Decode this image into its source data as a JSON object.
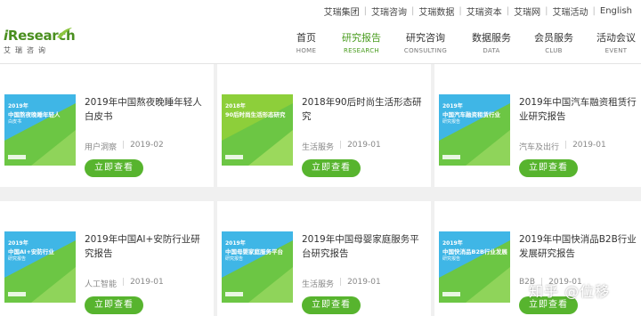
{
  "top_links": [
    "艾瑞集团",
    "艾瑞咨询",
    "艾瑞数据",
    "艾瑞资本",
    "艾瑞网",
    "艾瑞活动",
    "English"
  ],
  "logo": {
    "main_i": "i",
    "main_rest": "Research",
    "sub": "艾瑞咨询"
  },
  "nav": [
    {
      "cn": "首页",
      "en": "HOME"
    },
    {
      "cn": "研究报告",
      "en": "RESEARCH"
    },
    {
      "cn": "研究咨询",
      "en": "CONSULTING"
    },
    {
      "cn": "数据服务",
      "en": "DATA"
    },
    {
      "cn": "会员服务",
      "en": "CLUB"
    },
    {
      "cn": "活动会议",
      "en": "EVENT"
    }
  ],
  "active_nav_index": 1,
  "cards": [
    {
      "title": "2019年中国熬夜晚睡年轻人白皮书",
      "category": "用户洞察",
      "date": "2019-02",
      "button": "立即查看",
      "thumb": {
        "line1": "2019年",
        "line2": "中国熬夜晚睡年轻人",
        "line3": "白皮书"
      }
    },
    {
      "title": "2018年90后时尚生活形态研究",
      "category": "生活服务",
      "date": "2019-01",
      "button": "立即查看",
      "thumb": {
        "line1": "2018年",
        "line2": "90后时尚生活形态研究",
        "line3": ""
      }
    },
    {
      "title": "2019年中国汽车融资租赁行业研究报告",
      "category": "汽车及出行",
      "date": "2019-01",
      "button": "立即查看",
      "thumb": {
        "line1": "2019年",
        "line2": "中国汽车融资租赁行业",
        "line3": "研究报告"
      }
    },
    {
      "title": "2019年中国AI+安防行业研究报告",
      "category": "人工智能",
      "date": "2019-01",
      "button": "立即查看",
      "thumb": {
        "line1": "2019年",
        "line2": "中国AI+安防行业",
        "line3": "研究报告"
      }
    },
    {
      "title": "2019年中国母婴家庭服务平台研究报告",
      "category": "生活服务",
      "date": "2019-01",
      "button": "立即查看",
      "thumb": {
        "line1": "2019年",
        "line2": "中国母婴家庭服务平台",
        "line3": "研究报告"
      }
    },
    {
      "title": "2019年中国快消品B2B行业发展研究报告",
      "category": "B2B",
      "date": "2019-01",
      "button": "立即查看",
      "thumb": {
        "line1": "2019年",
        "line2": "中国快消品B2B行业发展",
        "line3": "研究报告"
      }
    }
  ],
  "watermark": "知乎 @位移",
  "colors": {
    "accent": "#4a9c1f",
    "button": "#57b42e",
    "thumb_blue": "#3fb6e6",
    "thumb_green": "#6cc644"
  }
}
